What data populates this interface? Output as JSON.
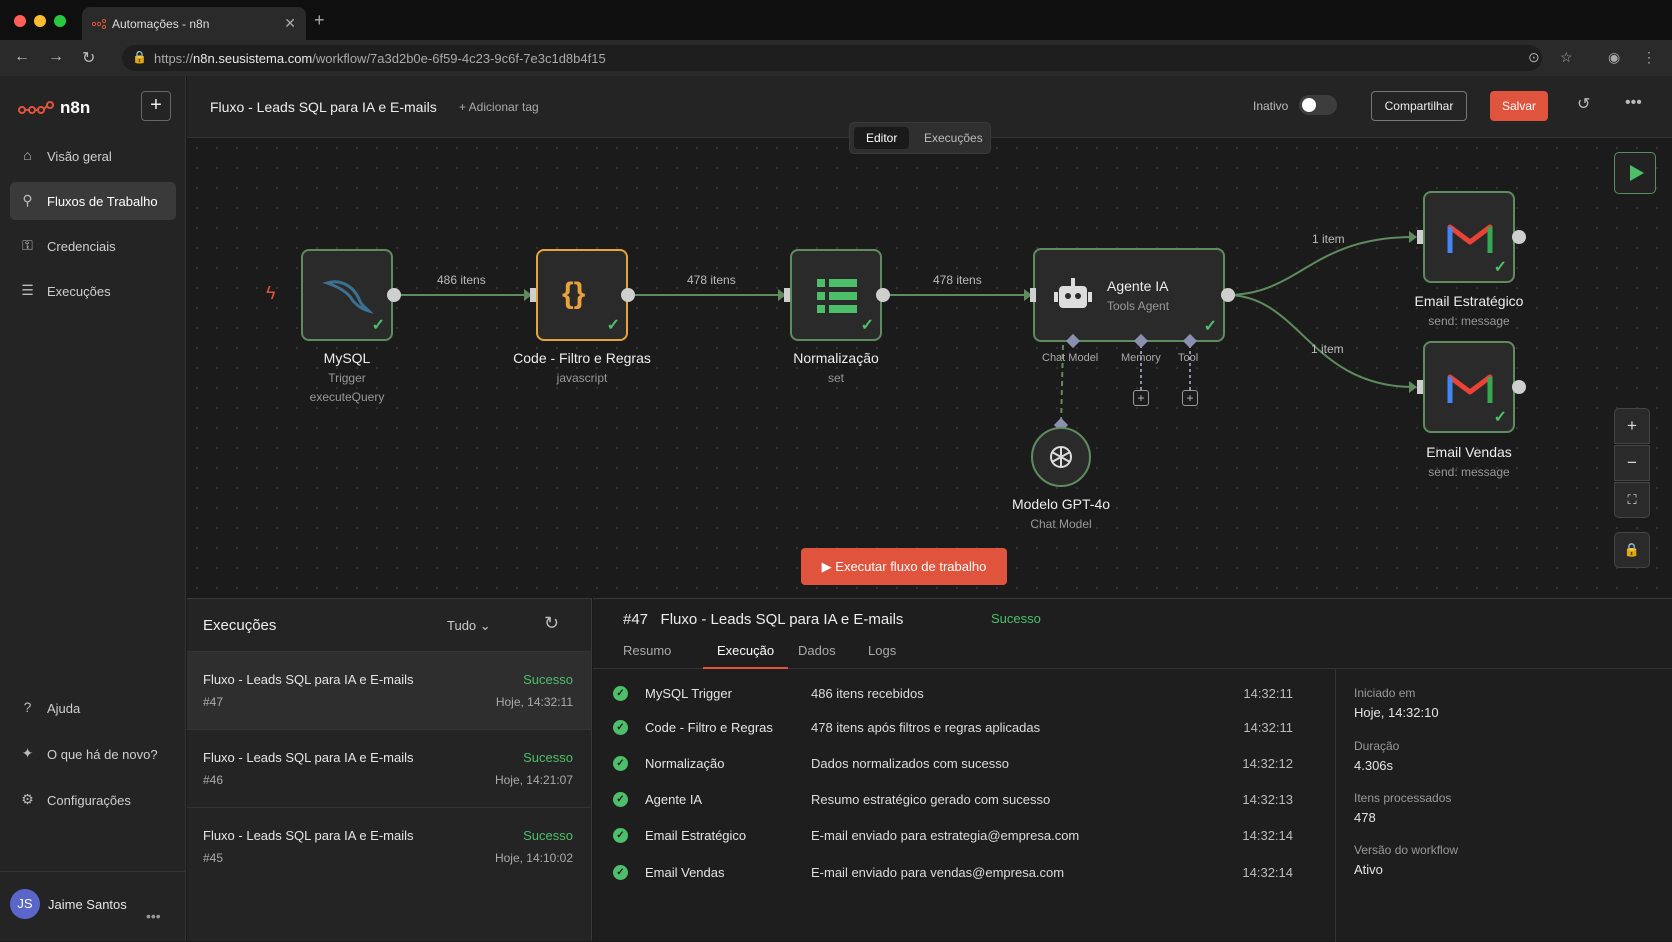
{
  "browser": {
    "tab_title": "Automações - n8n",
    "url_prefix": "https://",
    "url_host": "n8n.seusistema.com",
    "url_path": "/workflow/7a3d2b0e-6f59-4c23-9c6f-7e3c1d8b4f15"
  },
  "sidebar": {
    "logo": "n8n",
    "items": [
      {
        "label": "Visão geral",
        "icon": "home-icon"
      },
      {
        "label": "Fluxos de Trabalho",
        "icon": "workflow-icon"
      },
      {
        "label": "Credenciais",
        "icon": "key-icon"
      },
      {
        "label": "Execuções",
        "icon": "list-icon"
      }
    ],
    "bottom_items": [
      {
        "label": "Ajuda",
        "icon": "help-icon"
      },
      {
        "label": "O que há de novo?",
        "icon": "gift-icon"
      },
      {
        "label": "Configurações",
        "icon": "gear-icon"
      }
    ],
    "user": {
      "initials": "JS",
      "name": "Jaime Santos"
    }
  },
  "header": {
    "title": "Fluxo - Leads SQL para IA e E-mails",
    "add_tag": "+ Adicionar tag",
    "status_label": "Inativo",
    "share": "Compartilhar",
    "save": "Salvar",
    "tabs": [
      "Editor",
      "Execuções"
    ]
  },
  "canvas": {
    "nodes": {
      "mysql": {
        "name": "MySQL",
        "sub1": "Trigger",
        "sub2": "executeQuery"
      },
      "code": {
        "name": "Code - Filtro e Regras",
        "sub": "javascript"
      },
      "norm": {
        "name": "Normalização",
        "sub": "set"
      },
      "agent": {
        "name": "Agente IA",
        "sub": "Tools Agent",
        "ports": [
          "Chat Model",
          "Memory",
          "Tool"
        ]
      },
      "model": {
        "name": "Modelo GPT-4o",
        "sub": "Chat Model"
      },
      "email1": {
        "name": "Email Estratégico",
        "sub": "send: message"
      },
      "email2": {
        "name": "Email Vendas",
        "sub": "send: message"
      }
    },
    "edges": {
      "e1": "486 itens",
      "e2": "478 itens",
      "e3": "478 itens",
      "e4": "1 item",
      "e5": "1 item"
    },
    "run_button": "Executar fluxo de trabalho",
    "accent_color": "#e0533c",
    "success_color": "#4dbf6a"
  },
  "executions": {
    "title": "Execuções",
    "filter": "Tudo",
    "rows": [
      {
        "title": "Fluxo - Leads SQL para IA e E-mails",
        "id": "#47",
        "status": "Sucesso",
        "date": "Hoje, 14:32:11"
      },
      {
        "title": "Fluxo - Leads SQL para IA e E-mails",
        "id": "#46",
        "status": "Sucesso",
        "date": "Hoje, 14:21:07"
      },
      {
        "title": "Fluxo - Leads SQL para IA e E-mails",
        "id": "#45",
        "status": "Sucesso",
        "date": "Hoje, 14:10:02"
      }
    ]
  },
  "detail": {
    "id": "#47",
    "title": "Fluxo - Leads SQL para IA e E-mails",
    "status": "Sucesso",
    "tabs": [
      "Resumo",
      "Execução",
      "Dados",
      "Logs"
    ],
    "log": [
      {
        "node": "MySQL Trigger",
        "msg": "486 itens recebidos",
        "time": "14:32:11"
      },
      {
        "node": "Code - Filtro e Regras",
        "msg": "478 itens após filtros e regras aplicadas",
        "time": "14:32:11"
      },
      {
        "node": "Normalização",
        "msg": "Dados normalizados com sucesso",
        "time": "14:32:12"
      },
      {
        "node": "Agente IA",
        "msg": "Resumo estratégico gerado com sucesso",
        "time": "14:32:13"
      },
      {
        "node": "Email Estratégico",
        "msg": "E-mail enviado para estrategia@empresa.com",
        "time": "14:32:14"
      },
      {
        "node": "Email Vendas",
        "msg": "E-mail enviado para vendas@empresa.com",
        "time": "14:32:14"
      }
    ],
    "meta": [
      {
        "label": "Iniciado em",
        "value": "Hoje, 14:32:10"
      },
      {
        "label": "Duração",
        "value": "4.306s"
      },
      {
        "label": "Itens processados",
        "value": "478"
      },
      {
        "label": "Versão do workflow",
        "value": "Ativo"
      }
    ]
  }
}
